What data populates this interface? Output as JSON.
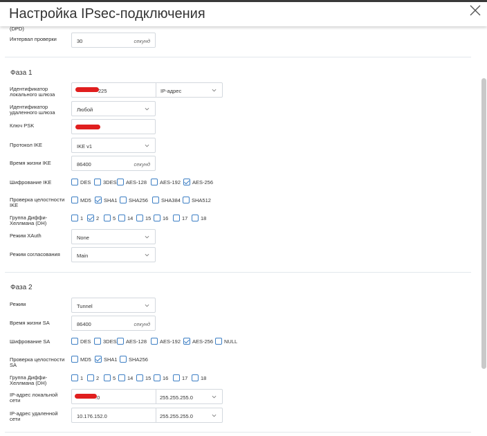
{
  "dialog": {
    "title": "Настройка IPsec-подключения"
  },
  "dpd": {
    "label_tail": "(DPD)",
    "interval_label": "Интервал проверки",
    "interval_value": "30",
    "interval_unit": "секунд"
  },
  "phase1": {
    "title": "Фаза 1",
    "local_id_label": "Идентификатор локального шлюза",
    "local_id_value": "225",
    "local_id_type": "IP-адрес",
    "remote_id_label": "Идентификатор удаленного шлюза",
    "remote_id_value": "Любой",
    "psk_label": "Ключ PSK",
    "ike_label": "Протокол IKE",
    "ike_value": "IKE v1",
    "lifetime_label": "Время жизни IKE",
    "lifetime_value": "86400",
    "lifetime_unit": "секунд",
    "enc_label": "Шифрование IKE",
    "enc_options": [
      {
        "label": "DES",
        "checked": false
      },
      {
        "label": "3DES",
        "checked": false
      },
      {
        "label": "AES-128",
        "checked": false
      },
      {
        "label": "AES-192",
        "checked": false
      },
      {
        "label": "AES-256",
        "checked": true
      }
    ],
    "integrity_label": "Проверка целостности IKE",
    "integrity_options": [
      {
        "label": "MD5",
        "checked": false
      },
      {
        "label": "SHA1",
        "checked": true
      },
      {
        "label": "SHA256",
        "checked": false
      },
      {
        "label": "SHA384",
        "checked": false
      },
      {
        "label": "SHA512",
        "checked": false
      }
    ],
    "dh_label": "Группа Диффи-Хеллмана (DH)",
    "dh_options": [
      {
        "label": "1",
        "checked": false
      },
      {
        "label": "2",
        "checked": true
      },
      {
        "label": "5",
        "checked": false
      },
      {
        "label": "14",
        "checked": false
      },
      {
        "label": "15",
        "checked": false
      },
      {
        "label": "16",
        "checked": false
      },
      {
        "label": "17",
        "checked": false
      },
      {
        "label": "18",
        "checked": false
      }
    ],
    "xauth_label": "Режим XAuth",
    "xauth_value": "None",
    "negotiation_label": "Режим согласования",
    "negotiation_value": "Main"
  },
  "phase2": {
    "title": "Фаза 2",
    "mode_label": "Режим",
    "mode_value": "Tunnel",
    "lifetime_label": "Время жизни SA",
    "lifetime_value": "86400",
    "lifetime_unit": "секунд",
    "enc_label": "Шифрование SA",
    "enc_options": [
      {
        "label": "DES",
        "checked": false
      },
      {
        "label": "3DES",
        "checked": false
      },
      {
        "label": "AES-128",
        "checked": false
      },
      {
        "label": "AES-192",
        "checked": false
      },
      {
        "label": "AES-256",
        "checked": true
      },
      {
        "label": "NULL",
        "checked": false
      }
    ],
    "integrity_label": "Проверка целостности SA",
    "integrity_options": [
      {
        "label": "MD5",
        "checked": false
      },
      {
        "label": "SHA1",
        "checked": true
      },
      {
        "label": "SHA256",
        "checked": false
      }
    ],
    "dh_label": "Группа Диффи-Хеллмана (DH)",
    "dh_options": [
      {
        "label": "1",
        "checked": false
      },
      {
        "label": "2",
        "checked": false
      },
      {
        "label": "5",
        "checked": false
      },
      {
        "label": "14",
        "checked": false
      },
      {
        "label": "15",
        "checked": false
      },
      {
        "label": "16",
        "checked": false
      },
      {
        "label": "17",
        "checked": false
      },
      {
        "label": "18",
        "checked": false
      }
    ],
    "local_net_label": "IP-адрес локальной сети",
    "local_net_value": ".0",
    "local_net_mask": "255.255.255.0",
    "remote_net_label": "IP-адрес удаленной сети",
    "remote_net_value": "10.176.152.0",
    "remote_net_mask": "255.255.255.0"
  },
  "colors": {
    "accent": "#3c7ec4",
    "redaction": "#e01e1e",
    "border": "#d3d8de"
  },
  "icons": {
    "close": "close-icon",
    "dropdown": "chevron-down-icon",
    "check": "checkmark-icon"
  }
}
